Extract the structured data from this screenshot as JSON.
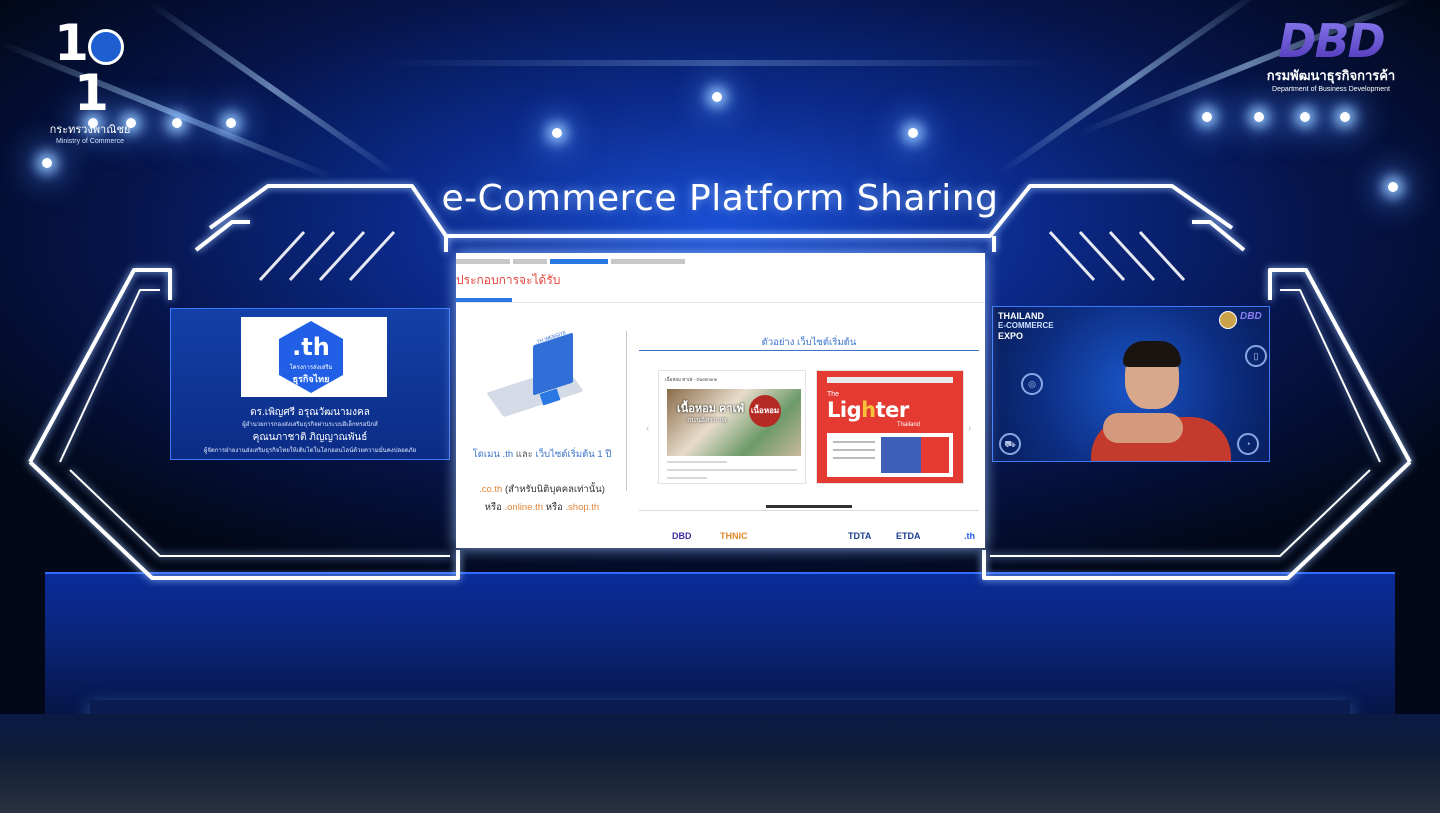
{
  "brand": {
    "left_logo": {
      "number": "101",
      "thai": "กระทรวงพาณิชย์",
      "english": "Ministry of Commerce"
    },
    "right_logo": {
      "mark": "DBD",
      "thai": "กรมพัฒนาธุรกิจการค้า",
      "english": "Department of Business Development"
    }
  },
  "event": {
    "title": "e-Commerce Platform Sharing"
  },
  "left_panel": {
    "logo_domain": ".th",
    "logo_project": "โครงการส่งเสริม",
    "logo_business": "ธุรกิจไทย",
    "speaker1_name": "ดร.เพิญศรี อรุณวัฒนามงคล",
    "speaker1_role": "ผู้อำนวยการกองส่งเสริมธุรกิจผ่านระบบอิเล็กทรอนิกส์",
    "speaker2_name": "คุณนภาชาติ ภิญญาณพันธ์",
    "speaker2_role": "ผู้จัดการฝ่ายงานส่งเสริมธุรกิจไทยให้เติบโตในโลกออนไลน์ด้วยความมั่นคงปลอดภัย"
  },
  "right_panel": {
    "expo_line1": "THAILAND",
    "expo_line2": "E-COMMERCE",
    "expo_line3": "EXPO",
    "dbd_mark": "DBD"
  },
  "slide": {
    "header": "ประกอบการจะได้รับ",
    "laptop_label": ".TH WEBSITE",
    "domain_highlight": "โดเมน .th",
    "domain_and": "และ",
    "domain_site": "เว็บไซต์เริ่มต้น 1 ปี",
    "coth": ".co.th",
    "coth_note": "(สำหรับนิติบุคคลเท่านั้น)",
    "or1": "หรือ",
    "online_th": ".online.th",
    "or2": "หรือ",
    "shop_th": ".shop.th",
    "example_title": "ตัวอย่าง เว็บไซต์เริ่มต้น",
    "site1_bar": "เนื้อหอม คาเฟ่ - Duetmone",
    "site1_headline": "เนื้อหอม คาเฟ่",
    "site1_sub": "ถนนอิสรภาพ",
    "site1_badge": "เนื้อหอม",
    "site2_the": "The",
    "site2_brand_a": "Lig",
    "site2_brand_b": "h",
    "site2_brand_c": "ter",
    "site2_country": "Thailand",
    "partners": [
      "DBD",
      "THNIC",
      "TDTA",
      "ETDA",
      ".th"
    ],
    "partner_colors": [
      "#3a2fa0",
      "#e28a2b",
      "#1d3f8f",
      "#1d3f8f",
      "#2160e6"
    ],
    "tab_active_index": 2
  },
  "colors": {
    "accent_blue": "#2a78e4",
    "header_red": "#e0473c",
    "orange": "#e2853a"
  }
}
